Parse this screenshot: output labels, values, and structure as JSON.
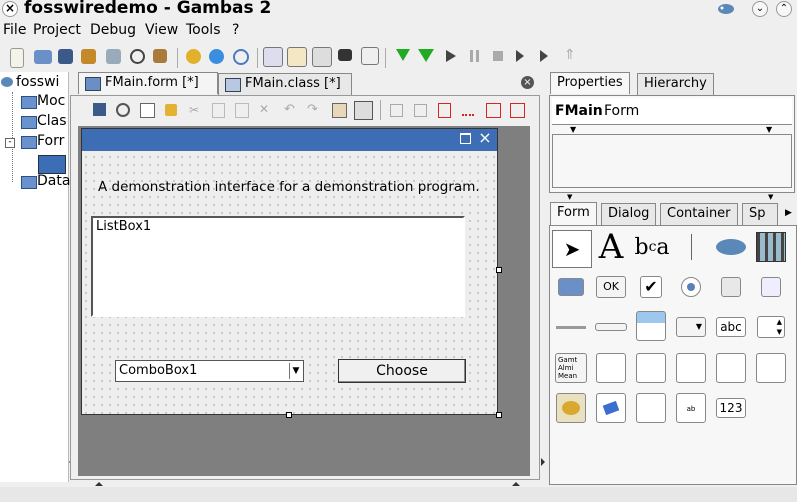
{
  "window": {
    "title": "fosswiredemo - Gambas 2"
  },
  "menu": [
    "File",
    "Project",
    "Debug",
    "View",
    "Tools",
    "?"
  ],
  "project_tree": {
    "root": "fosswi",
    "items": [
      "Moc",
      "Clas",
      "Forr",
      "Data"
    ]
  },
  "editor_tabs": [
    "FMain.form [*]",
    "FMain.class [*]"
  ],
  "form": {
    "label_text": "A demonstration interface for a demonstration program.",
    "listbox": "ListBox1",
    "combobox": "ComboBox1",
    "button": "Choose"
  },
  "properties": {
    "tabs": [
      "Properties",
      "Hierarchy"
    ],
    "object_name": "FMain",
    "object_type": "Form"
  },
  "toolbox": {
    "tabs": [
      "Form",
      "Dialog",
      "Container",
      "Sp"
    ],
    "ok_label": "OK",
    "textbox_label": "abc",
    "valuebox_label": "123",
    "gridlist_text": [
      "Gamt",
      "Almi",
      "Mean"
    ]
  },
  "colors": {
    "form_title": "#3d6eb5",
    "canvas": "#7f7f7f",
    "toolbar_red": "#d22"
  }
}
